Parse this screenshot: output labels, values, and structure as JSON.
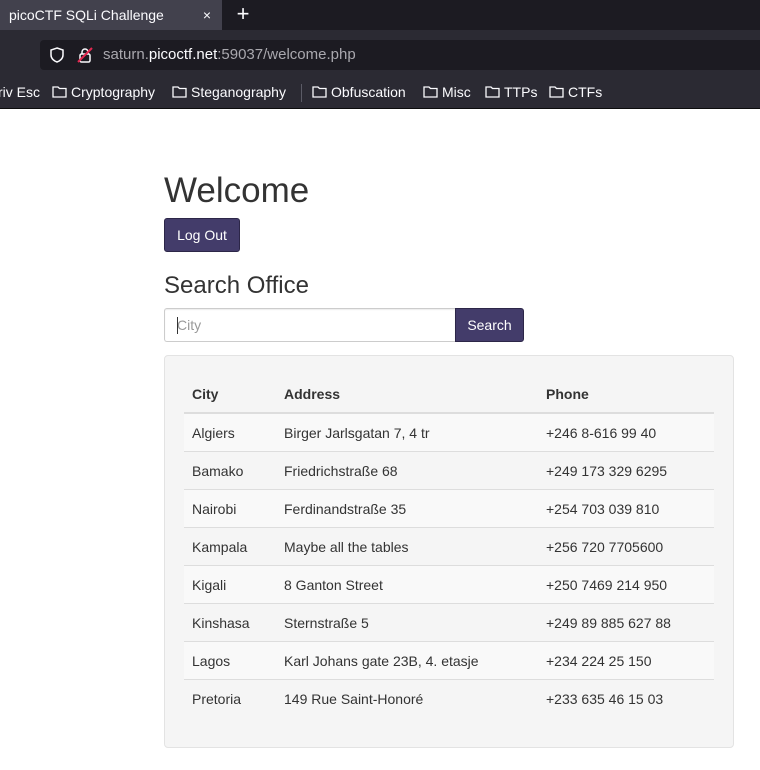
{
  "browser": {
    "tab_title": "picoCTF SQLi Challenge",
    "tab_close": "×",
    "new_tab": "+",
    "url_prefix": "saturn.",
    "url_host": "picoctf.net",
    "url_suffix": ":59037/welcome.php",
    "bookmarks": [
      {
        "label": "riv Esc",
        "icon": ""
      },
      {
        "label": "Cryptography",
        "icon": "folder-icon"
      },
      {
        "label": "Steganography",
        "icon": "folder-icon"
      },
      {
        "label": "Obfuscation",
        "icon": "folder-icon"
      },
      {
        "label": "Misc",
        "icon": "folder-icon"
      },
      {
        "label": "TTPs",
        "icon": "folder-icon"
      },
      {
        "label": "CTFs",
        "icon": "folder-icon"
      }
    ]
  },
  "page": {
    "heading": "Welcome",
    "logout_label": "Log Out",
    "search_heading": "Search Office",
    "search_placeholder": "City",
    "search_value": "",
    "search_button": "Search",
    "colors": {
      "button": "#433c6a",
      "well": "#f5f5f5"
    }
  },
  "table": {
    "headers": [
      "City",
      "Address",
      "Phone"
    ],
    "rows": [
      [
        "Algiers",
        "Birger Jarlsgatan 7, 4 tr",
        "+246 8-616 99 40"
      ],
      [
        "Bamako",
        "Friedrichstraße 68",
        "+249 173 329 6295"
      ],
      [
        "Nairobi",
        "Ferdinandstraße 35",
        "+254 703 039 810"
      ],
      [
        "Kampala",
        "Maybe all the tables",
        "+256 720 7705600"
      ],
      [
        "Kigali",
        "8 Ganton Street",
        "+250 7469 214 950"
      ],
      [
        "Kinshasa",
        "Sternstraße 5",
        "+249 89 885 627 88"
      ],
      [
        "Lagos",
        "Karl Johans gate 23B, 4. etasje",
        "+234 224 25 150"
      ],
      [
        "Pretoria",
        "149 Rue Saint-Honoré",
        "+233 635 46 15 03"
      ]
    ]
  }
}
